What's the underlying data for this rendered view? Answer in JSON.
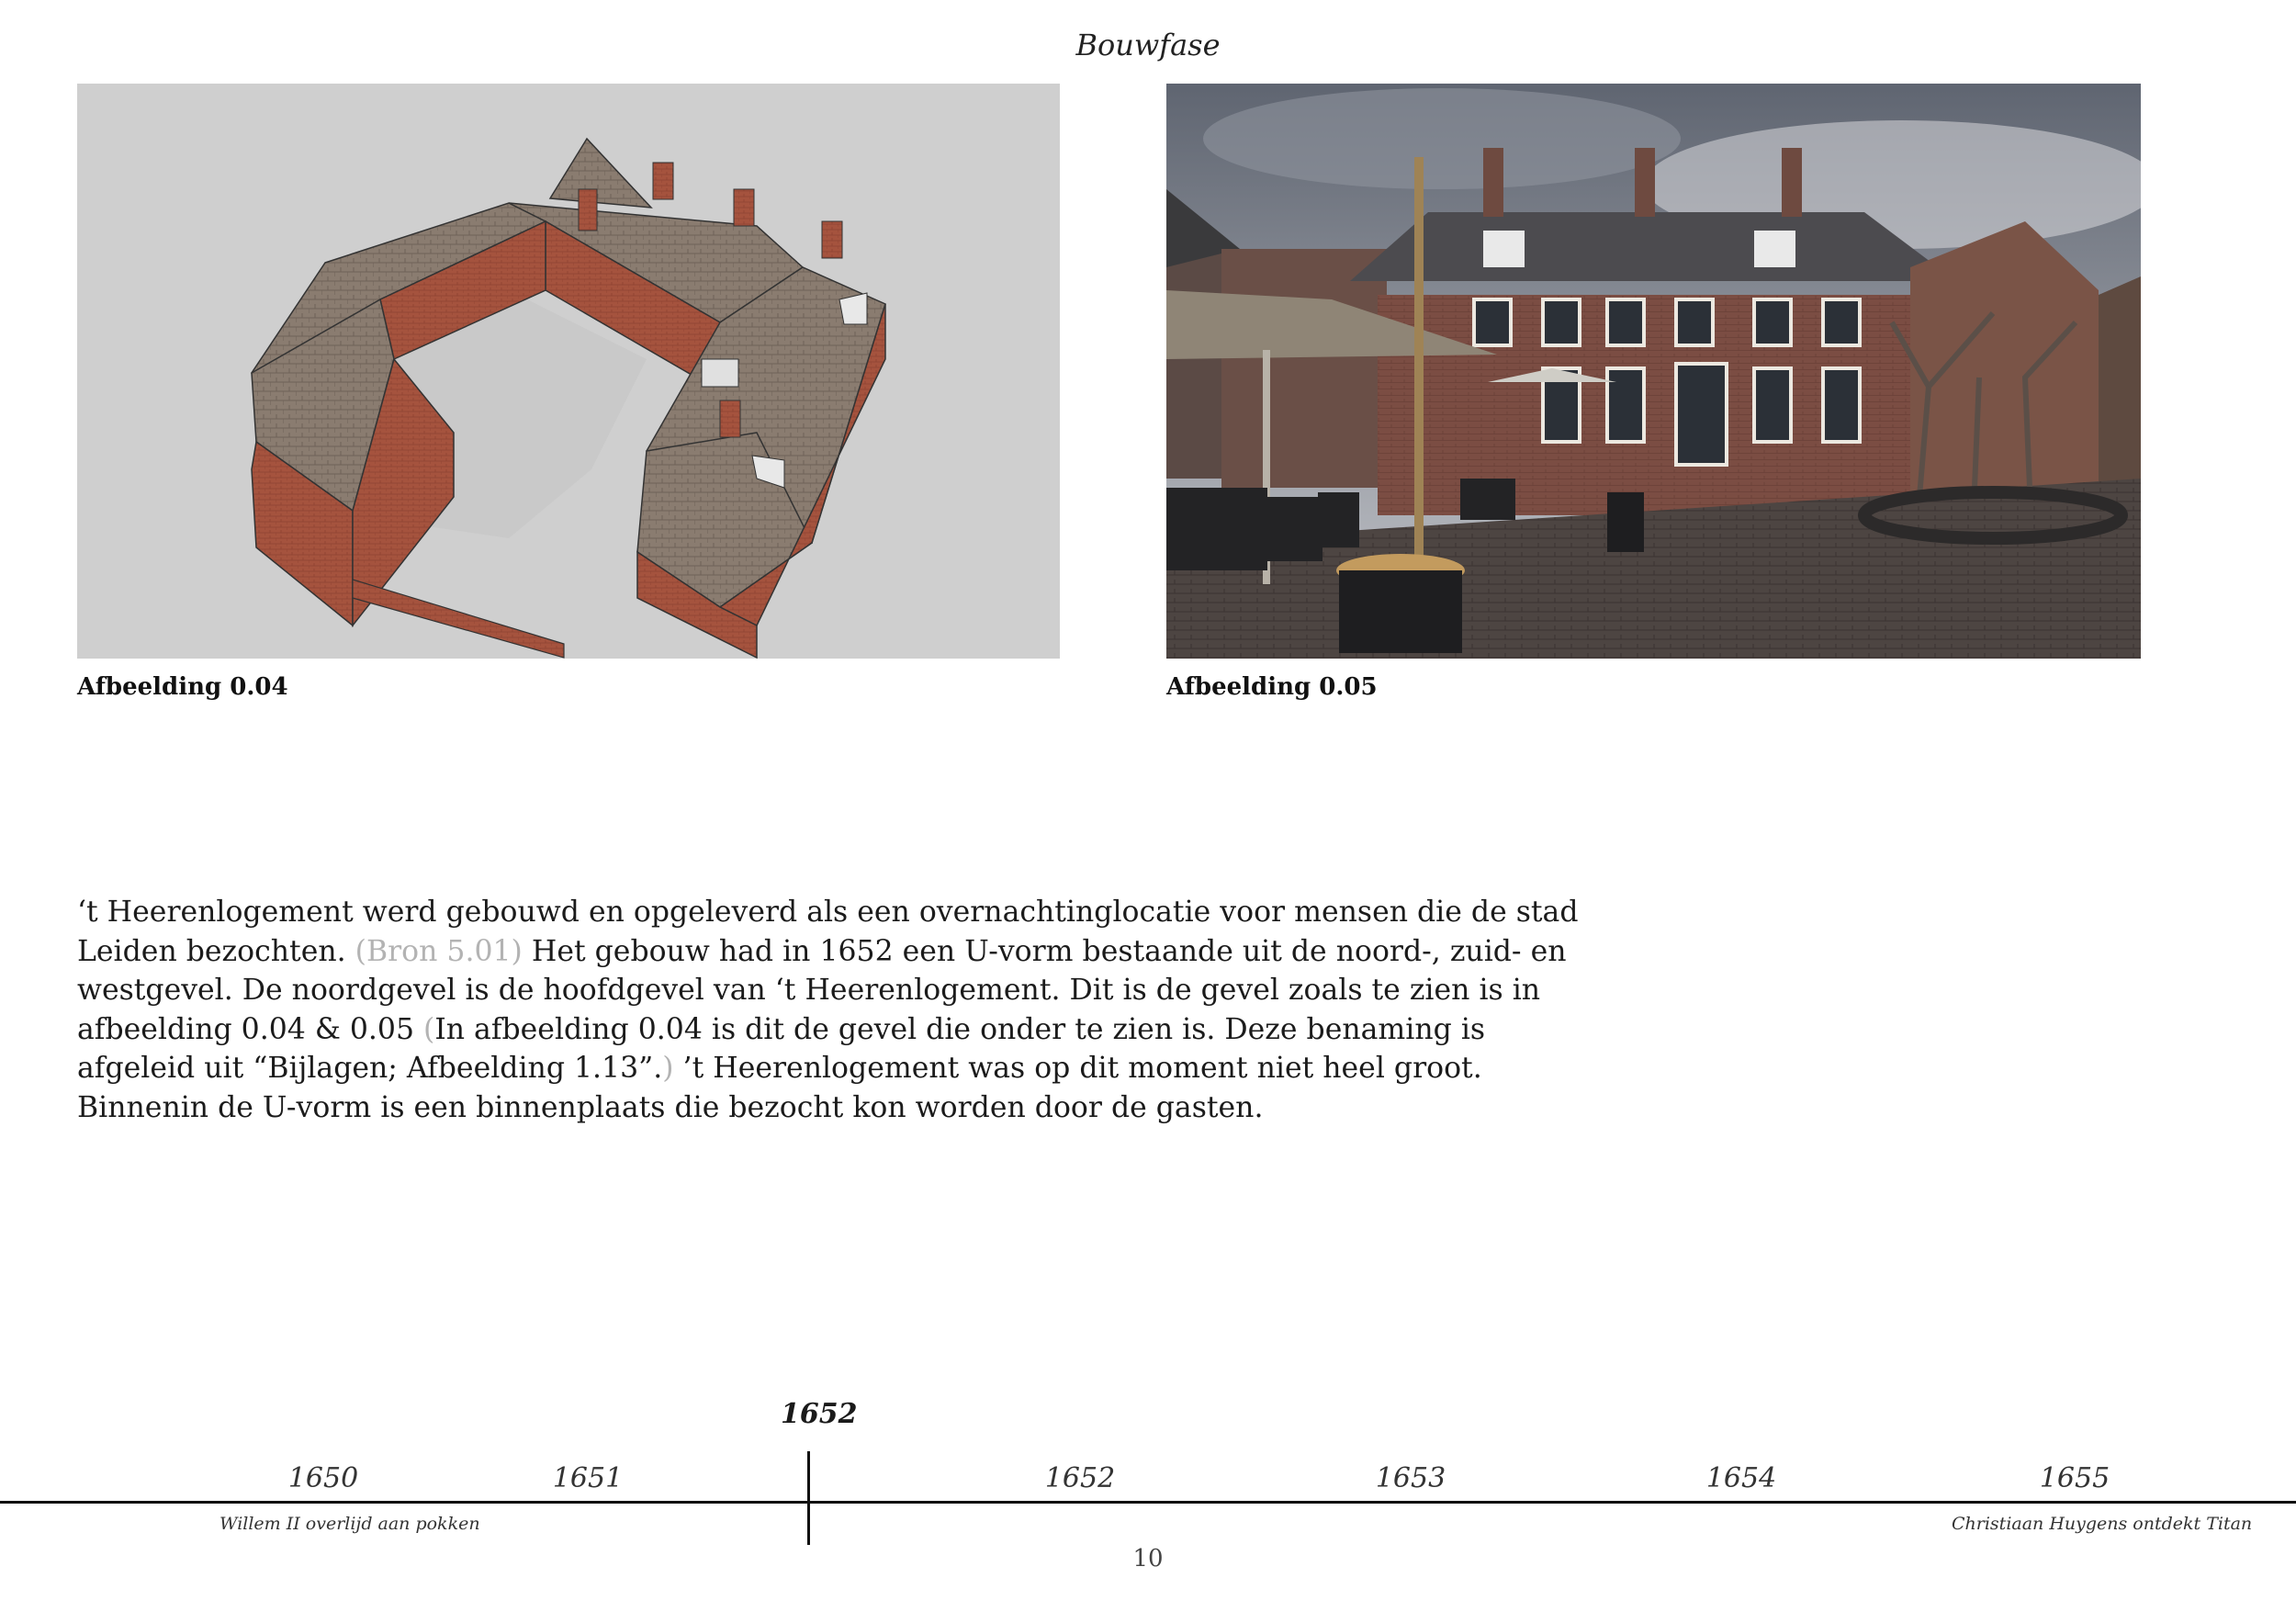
{
  "header": {
    "title": "Bouwfase"
  },
  "figures": [
    {
      "caption": "Afbeelding 0.04"
    },
    {
      "caption": "Afbeelding 0.05"
    }
  ],
  "body": {
    "lines": [
      {
        "parts": [
          "‘t Heerenlogement werd gebouwd en opgeleverd als een overnachtinglocatie voor mensen die de stad"
        ]
      },
      {
        "pre": "Leiden bezochten. ",
        "muted": "(Bron 5.01)",
        "post": " Het gebouw had in 1652 een U-vorm bestaande uit de noord-, zuid- en"
      },
      {
        "parts": [
          "westgevel. De noordgevel is de hoofdgevel van ‘t Heerenlogement. Dit is de gevel zoals te zien is in"
        ]
      },
      {
        "pre": "afbeelding 0.04 & 0.05 ",
        "muted": "(",
        "post": "In afbeelding 0.04 is dit de gevel die onder te zien is. Deze benaming is"
      },
      {
        "pre": "afgeleid uit “Bijlagen; Afbeelding 1.13”.",
        "muted": ")",
        "post": " ’t Heerenlogement was op dit moment niet heel groot."
      },
      {
        "parts": [
          "Binnenin de U-vorm is een binnenplaats die bezocht kon worden door de gasten."
        ]
      }
    ]
  },
  "timeline": {
    "current_year": "1652",
    "years": [
      "1650",
      "1651",
      "1652",
      "1653",
      "1654",
      "1655"
    ],
    "events": [
      {
        "text": "Willem II overlijd aan pokken"
      },
      {
        "text": "Christiaan Huygens ontdekt Titan"
      }
    ]
  },
  "footer": {
    "page_number": "10"
  }
}
